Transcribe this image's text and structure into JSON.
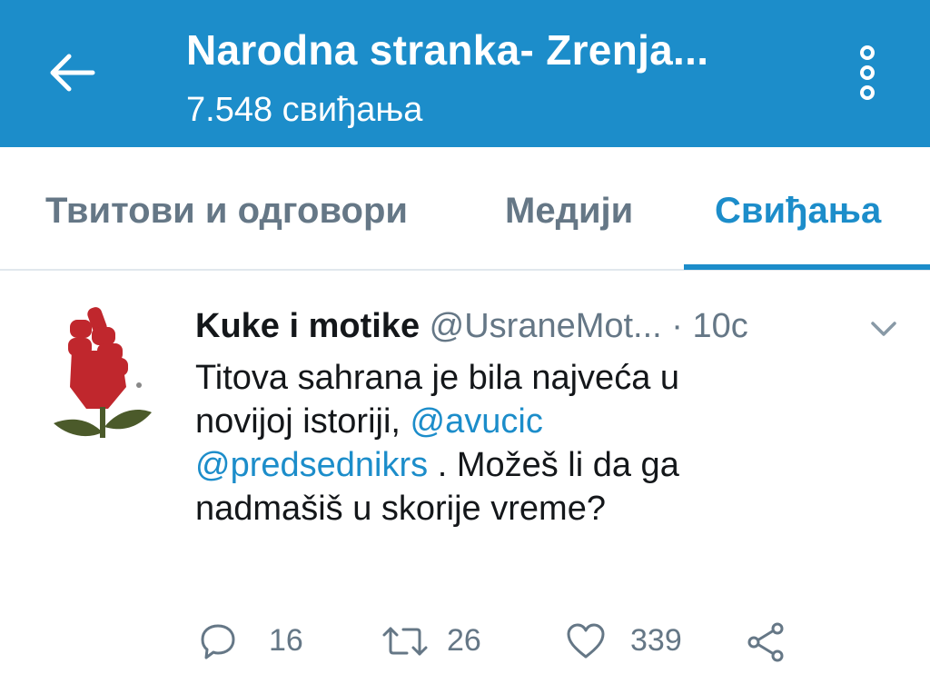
{
  "header": {
    "title": "Narodna stranka- Zrenja...",
    "subtitle": "7.548 свиђања",
    "back_icon": "arrow-left-icon",
    "more_icon": "more-vertical-icon"
  },
  "tabs": [
    {
      "label": "Твитови и одговори",
      "active": false
    },
    {
      "label": "Медији",
      "active": false
    },
    {
      "label": "Свиђања",
      "active": true
    }
  ],
  "tweet": {
    "author_name": "Kuke i motike",
    "author_handle": "@UsraneMot...",
    "separator": "·",
    "time": "10с",
    "lines": {
      "l1": "Titova sahrana je bila najveća u",
      "l2_prefix": "novijoj istoriji, ",
      "mention1": "@avucic",
      "mention2": "@predsednikrs",
      "l3_suffix": " . Možeš li da ga",
      "l4": "nadmašiš u skorije vreme?"
    },
    "actions": {
      "replies": "16",
      "retweets": "26",
      "likes": "339"
    }
  },
  "colors": {
    "brand": "#1c8dca",
    "text": "#14171a",
    "secondary": "#657786",
    "divider": "#e1e8ed",
    "fist": "#c0272d",
    "leaf": "#4b5a2a"
  }
}
